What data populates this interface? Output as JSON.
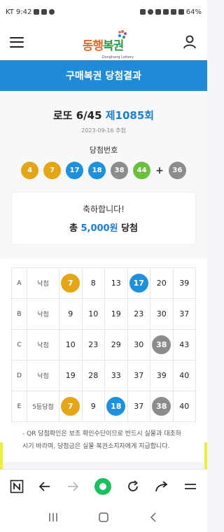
{
  "status_bar": {
    "carrier": "KT",
    "time": "9:42",
    "battery": "64%"
  },
  "header": {
    "logo_text": "동행복권",
    "logo_sub": "Donghang Lottery"
  },
  "page_title": "구매복권 당첨결과",
  "draw": {
    "game": "로또 6/45",
    "round": "제1085회",
    "date": "2023-09-16 추첨",
    "winning_label": "당첨번호",
    "numbers": [
      "4",
      "7",
      "17",
      "18",
      "38",
      "44"
    ],
    "bonus": "36",
    "plus": "+"
  },
  "result": {
    "message": "축하합니다!",
    "prefix": "총",
    "amount": "5,000원",
    "suffix": "당첨"
  },
  "ticket": {
    "rows": [
      {
        "label": "A",
        "status": "낙첨",
        "numbers": [
          "7",
          "8",
          "13",
          "17",
          "20",
          "39"
        ]
      },
      {
        "label": "B",
        "status": "낙첨",
        "numbers": [
          "9",
          "10",
          "19",
          "23",
          "30",
          "37"
        ]
      },
      {
        "label": "C",
        "status": "낙첨",
        "numbers": [
          "10",
          "23",
          "29",
          "30",
          "38",
          "43"
        ]
      },
      {
        "label": "D",
        "status": "낙첨",
        "numbers": [
          "19",
          "28",
          "33",
          "37",
          "39",
          "40"
        ]
      },
      {
        "label": "E",
        "status": "5등당첨",
        "numbers": [
          "7",
          "9",
          "18",
          "37",
          "38",
          "40"
        ]
      }
    ]
  },
  "notice": "- QR 당첨확인은 보조 확인수단이므로 반드시 실물과 대조하시기 바라며, 당첨금은 실물 복권소지자에게 지급합니다.",
  "colors": {
    "yellow_ball": "#e4a516",
    "blue_ball": "#1e90dc",
    "gray_ball": "#8c8c8c",
    "green_ball": "#6bbf3c",
    "banner": "#1f8ad6",
    "accent_text": "#1f7bd0"
  },
  "browser_bar": {
    "icons": [
      "naver-n-icon",
      "back-icon",
      "forward-icon",
      "home-dot-icon",
      "refresh-icon",
      "share-icon",
      "menu-icon"
    ]
  },
  "system_nav": {
    "icons": [
      "recents-icon",
      "home-icon",
      "back-icon"
    ]
  }
}
